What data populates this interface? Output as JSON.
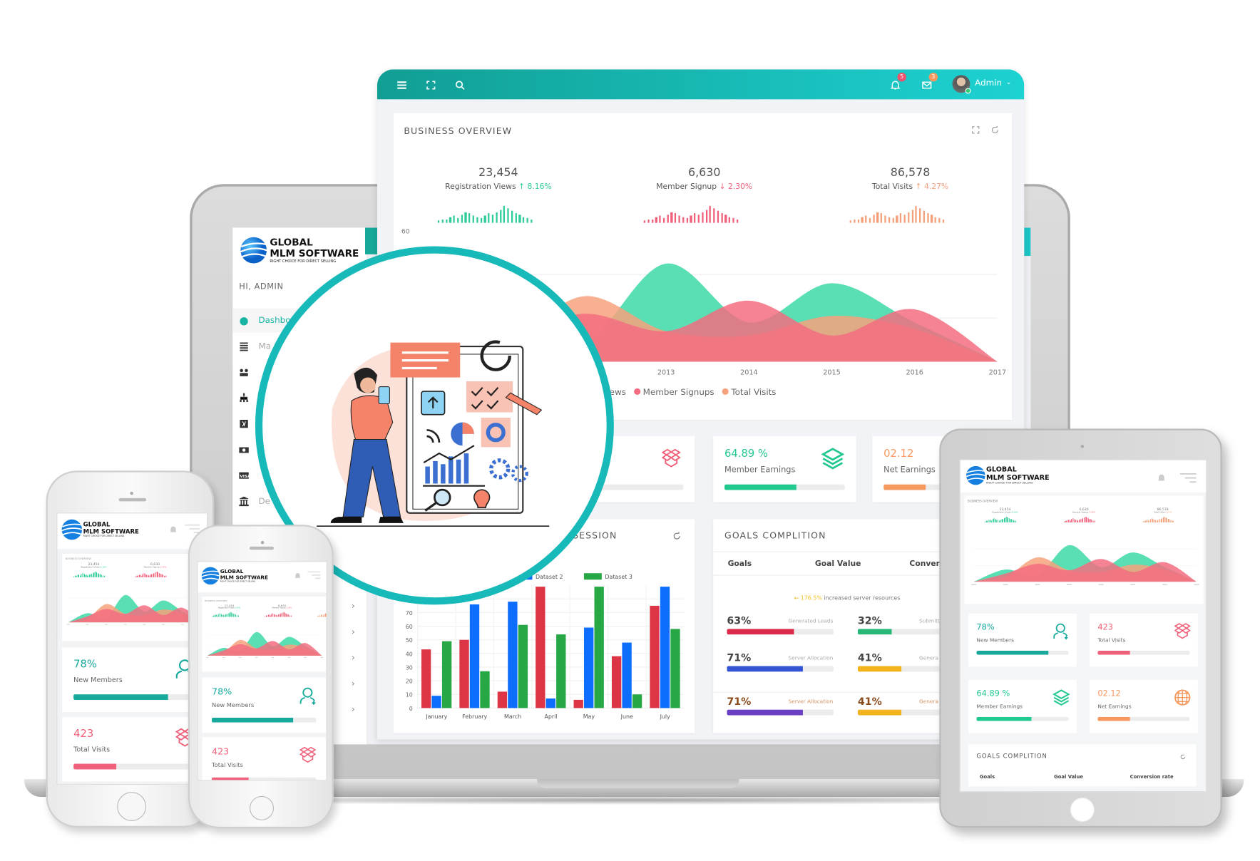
{
  "brand": {
    "line1": "GLOBAL",
    "line2": "MLM SOFTWARE",
    "tagline": "RIGHT CHOICE FOR DIRECT SELLING"
  },
  "topbar": {
    "notifications_count": "5",
    "messages_count": "3",
    "user": "Admin",
    "accent_start": "#119e94",
    "accent_end": "#1dd2d2"
  },
  "sidebar": {
    "greeting": "HI, ADMIN",
    "items": [
      {
        "label": "Dashboard",
        "icon": "dashboard-icon",
        "active": true
      },
      {
        "label": "Ma",
        "icon": "list-icon"
      },
      {
        "label": "",
        "icon": "users-icon"
      },
      {
        "label": "",
        "icon": "sitemap-icon"
      },
      {
        "label": "",
        "icon": "xing-icon"
      },
      {
        "label": "",
        "icon": "money-icon"
      },
      {
        "label": "",
        "icon": "visa-icon"
      },
      {
        "label": "De",
        "icon": "bank-icon"
      }
    ]
  },
  "overview": {
    "title": "BUSINESS OVERVIEW",
    "stats": [
      {
        "value": "23,454",
        "label": "Registration Views",
        "arrow": "↑",
        "change": "8.16%",
        "color": "#2ecc9a"
      },
      {
        "value": "6,630",
        "label": "Member Signup",
        "arrow": "↓",
        "change": "2.30%",
        "color": "#f0607a"
      },
      {
        "value": "86,578",
        "label": "Total Visits",
        "arrow": "↑",
        "change": "4.27%",
        "color": "#f4a07a"
      }
    ]
  },
  "cards": {
    "new_members": {
      "value": "78%",
      "label": "New Members",
      "progress": 78,
      "color": "#17a99c"
    },
    "total_visits": {
      "value": "423",
      "label": "Total Visits",
      "progress": 35,
      "color": "#f0607a"
    },
    "member_earnings": {
      "value": "64.89 %",
      "label": "Member Earnings",
      "progress": 60,
      "color": "#22c98f"
    },
    "net_earnings": {
      "value": "02.12",
      "label": "Net Earnings",
      "progress": 35,
      "color": "#f7995f"
    }
  },
  "session": {
    "title": "SESSION"
  },
  "goals": {
    "title": "GOALS COMPLITION",
    "headers": [
      "Goals",
      "Goal Value",
      "Convers",
      "Conversion rate"
    ],
    "note_arrow": "←",
    "note_value": "176.5%",
    "note_text": "increased server resources",
    "rows": [
      {
        "pct": "63%",
        "label": "Generated Leads",
        "progress": 63,
        "color": "#dc2a4a"
      },
      {
        "pct": "32%",
        "label": "Submitte",
        "progress": 32,
        "color": "#27b878"
      },
      {
        "pct": "71%",
        "label": "Server Allocation",
        "progress": 71,
        "color": "#3455d1"
      },
      {
        "pct": "41%",
        "label": "Genera",
        "progress": 41,
        "color": "#f1b41c"
      },
      {
        "pct": "71%",
        "label": "Server Allocation",
        "progress": 71,
        "color": "#6a3fc4"
      },
      {
        "pct": "41%",
        "label": "Genera",
        "progress": 41,
        "color": "#f1b41c"
      }
    ]
  },
  "chart_data": [
    {
      "type": "area",
      "categories": [
        "2010",
        "2011",
        "2012",
        "2013",
        "2014",
        "2015",
        "2016",
        "2017"
      ],
      "ylim": [
        0,
        60
      ],
      "yticks_shown": [
        "60"
      ],
      "grid": true,
      "legend": "bottom",
      "series": [
        {
          "name": "Registration Views",
          "color": "#3dd9a8",
          "values": [
            0,
            15,
            8,
            45,
            18,
            36,
            18,
            0
          ]
        },
        {
          "name": "Total Visits",
          "color": "#f6a27c",
          "values": [
            0,
            6,
            30,
            14,
            12,
            21,
            15,
            0
          ]
        },
        {
          "name": "Member Signups",
          "color": "#f36d80",
          "values": [
            0,
            10,
            22,
            14,
            28,
            12,
            24,
            0
          ]
        }
      ]
    },
    {
      "type": "bar",
      "categories": [
        "January",
        "February",
        "March",
        "April",
        "May",
        "June",
        "July"
      ],
      "ylim": [
        0,
        90
      ],
      "yticks": [
        0,
        10,
        20,
        30,
        40,
        50,
        60,
        70,
        80
      ],
      "grid": true,
      "legend": "top",
      "series": [
        {
          "color": "#dc3545",
          "values": [
            43,
            50,
            12,
            89,
            6,
            38,
            75
          ]
        },
        {
          "name": "Dataset 2",
          "color": "#0d6efd",
          "values": [
            9,
            76,
            78,
            7,
            59,
            48,
            89
          ]
        },
        {
          "name": "Dataset 3",
          "color": "#28a745",
          "values": [
            49,
            27,
            61,
            54,
            89,
            10,
            58
          ]
        }
      ]
    }
  ]
}
